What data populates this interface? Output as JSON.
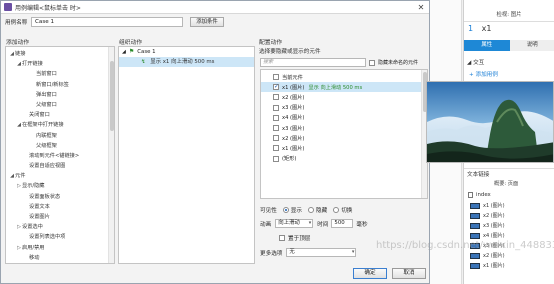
{
  "dialog": {
    "title": "用例编辑<鼠标单击 时>",
    "case_name_label": "用例名称",
    "case_name_value": "Case 1",
    "add_condition_label": "添加条件",
    "ok_label": "确定",
    "cancel_label": "取消"
  },
  "columns": {
    "add_action": "添加动作",
    "organize_action": "组织动作",
    "configure_action": "配置动作"
  },
  "actions_tree": [
    {
      "label": "链接",
      "indent": 0,
      "arrow": "◢"
    },
    {
      "label": "打开链接",
      "indent": 1,
      "arrow": "◢"
    },
    {
      "label": "当前窗口",
      "indent": 3,
      "arrow": ""
    },
    {
      "label": "新窗口/新标签",
      "indent": 3,
      "arrow": ""
    },
    {
      "label": "弹出窗口",
      "indent": 3,
      "arrow": ""
    },
    {
      "label": "父级窗口",
      "indent": 3,
      "arrow": ""
    },
    {
      "label": "关闭窗口",
      "indent": 2,
      "arrow": ""
    },
    {
      "label": "在框架中打开链接",
      "indent": 1,
      "arrow": "◢"
    },
    {
      "label": "内联框架",
      "indent": 3,
      "arrow": ""
    },
    {
      "label": "父级框架",
      "indent": 3,
      "arrow": ""
    },
    {
      "label": "滚动到元件<锚链接>",
      "indent": 2,
      "arrow": ""
    },
    {
      "label": "设置自适应视图",
      "indent": 2,
      "arrow": ""
    },
    {
      "label": "元件",
      "indent": 0,
      "arrow": "◢"
    },
    {
      "label": "显示/隐藏",
      "indent": 1,
      "arrow": "▷"
    },
    {
      "label": "设置面板状态",
      "indent": 2,
      "arrow": ""
    },
    {
      "label": "设置文本",
      "indent": 2,
      "arrow": ""
    },
    {
      "label": "设置图片",
      "indent": 2,
      "arrow": ""
    },
    {
      "label": "设置选中",
      "indent": 1,
      "arrow": "▷"
    },
    {
      "label": "设置列表选中项",
      "indent": 2,
      "arrow": ""
    },
    {
      "label": "启用/禁用",
      "indent": 1,
      "arrow": "▷"
    },
    {
      "label": "移动",
      "indent": 2,
      "arrow": ""
    }
  ],
  "organize": {
    "case_label": "Case 1",
    "action_label": "显示 x1 向上滑动 500 ms"
  },
  "configure": {
    "title": "选择要隐藏或显示的元件",
    "search_placeholder": "搜索",
    "hide_unnamed_label": "隐藏未命名的元件",
    "elements": [
      {
        "label": "当前元件",
        "checked": false,
        "action": ""
      },
      {
        "label": "x1 (图片)",
        "checked": true,
        "action": "显示 向上滑动 500 ms"
      },
      {
        "label": "x2 (图片)",
        "checked": false,
        "action": ""
      },
      {
        "label": "x3 (图片)",
        "checked": false,
        "action": ""
      },
      {
        "label": "x4 (图片)",
        "checked": false,
        "action": ""
      },
      {
        "label": "x3 (图片)",
        "checked": false,
        "action": ""
      },
      {
        "label": "x2 (图片)",
        "checked": false,
        "action": ""
      },
      {
        "label": "x1 (图片)",
        "checked": false,
        "action": ""
      },
      {
        "label": "(矩形)",
        "checked": false,
        "action": ""
      }
    ],
    "visibility_label": "可见性",
    "vis_show": "显示",
    "vis_hide": "隐藏",
    "vis_toggle": "切换",
    "animation_label": "动画",
    "animation_value": "向上滑动",
    "time_label": "时间",
    "time_value": "500",
    "ms_label": "毫秒",
    "bring_to_front_label": "置于顶层",
    "more_options_label": "更多选项",
    "more_options_value": "无"
  },
  "right_panel": {
    "tab_inspect": "检视: 图片",
    "page_num": "1",
    "widget_name": "x1",
    "tab_properties": "属性",
    "tab_notes": "说明",
    "interaction_label": "交互",
    "add_case_label": "添加用例",
    "text_link_label": "文本链接",
    "outline_tab": "概要: 页面",
    "index_label": "index",
    "layers": [
      "x1 (图片)",
      "x2 (图片)",
      "x3 (图片)",
      "x4 (图片)",
      "x3 (图片)",
      "x2 (图片)",
      "x1 (图片)"
    ]
  },
  "watermark": "https://blog.csdn.net/weixin_44883323"
}
